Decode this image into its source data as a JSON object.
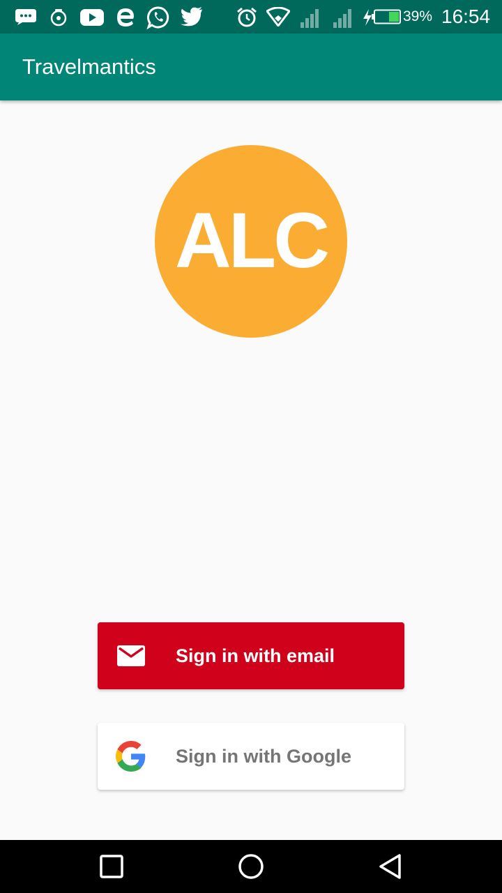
{
  "status_bar": {
    "battery_percent": "39%",
    "time": "16:54",
    "icons": [
      "chat-icon",
      "camera-icon",
      "youtube-icon",
      "browser-e-icon",
      "whatsapp-icon",
      "twitter-icon",
      "alarm-icon",
      "wifi-icon",
      "signal-icon",
      "signal-icon",
      "charging-icon",
      "battery-icon"
    ]
  },
  "app_bar": {
    "title": "Travelmantics",
    "color": "#008577"
  },
  "logo": {
    "text": "ALC",
    "color": "#fbad33"
  },
  "auth": {
    "email_button": {
      "label": "Sign in with email",
      "icon": "mail-icon",
      "color": "#d0021b"
    },
    "google_button": {
      "label": "Sign in with Google",
      "icon": "google-g-icon",
      "color": "#ffffff"
    }
  },
  "nav_bar": {
    "buttons": [
      "recent-apps",
      "home",
      "back"
    ]
  }
}
